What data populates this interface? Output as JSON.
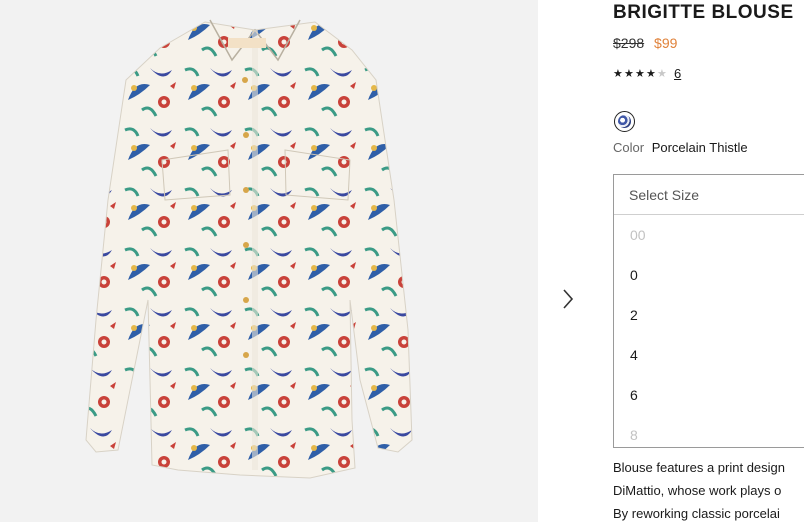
{
  "product": {
    "title": "BRIGITTE BLOUSE",
    "price_original": "$298",
    "price_sale": "$99",
    "rating": 4,
    "rating_max": 5,
    "review_count": "6",
    "color_label": "Color",
    "color_value": "Porcelain Thistle",
    "brand_colors": {
      "sale": "#e0823a",
      "text": "#1a1a1a",
      "muted": "#666666"
    }
  },
  "size": {
    "placeholder": "Select Size",
    "options": [
      {
        "label": "00",
        "available": false
      },
      {
        "label": "0",
        "available": true
      },
      {
        "label": "2",
        "available": true
      },
      {
        "label": "4",
        "available": true
      },
      {
        "label": "6",
        "available": true
      },
      {
        "label": "8",
        "available": false
      }
    ]
  },
  "description": {
    "lines": [
      "Blouse features a print design",
      "DiMattio, whose work plays o",
      "By reworking classic porcelai"
    ]
  },
  "gallery": {
    "next_icon": "chevron-right-icon"
  }
}
